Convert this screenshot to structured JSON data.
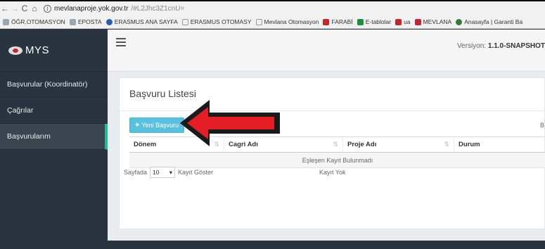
{
  "browser": {
    "url_host": "mevlanaproje.yok.gov.tr",
    "url_rest": "/#L2Jhc3Z1cnU=",
    "bookmarks": [
      {
        "label": "ÖĞR.OTOMASYON",
        "color": "#9aa7b4"
      },
      {
        "label": "EPOSTA",
        "color": "#9aa7b4"
      },
      {
        "label": "ERASMUS ANA SAYFA",
        "color": "#2a5db0"
      },
      {
        "label": "ERASMUS OTOMASY",
        "color": "#bbbbbb"
      },
      {
        "label": "Mevlana Otomasyon",
        "color": "#bbbbbb"
      },
      {
        "label": "FARABİ",
        "color": "#c0282d"
      },
      {
        "label": "E-tablolar",
        "color": "#1e8e3e"
      },
      {
        "label": "ua",
        "color": "#c0282d"
      },
      {
        "label": "MEVLANA",
        "color": "#c0282d"
      },
      {
        "label": "Anasayfa | Garanti Ba",
        "color": "#2e7d32"
      }
    ]
  },
  "app": {
    "brand": "MYS",
    "version_label": "Versiyon:",
    "version_value": "1.1.0-SNAPSHOT",
    "sidebar": {
      "items": [
        {
          "label": "Başvurular (Koordinatör)"
        },
        {
          "label": "Çağrılar"
        },
        {
          "label": "Başvurularım"
        }
      ]
    }
  },
  "main": {
    "title": "Başvuru Listesi",
    "new_button": "Yeni Başvuru",
    "search_cut": "B",
    "table": {
      "columns": [
        "Dönem",
        "Cagri Adı",
        "Proje Adı",
        "Durum"
      ],
      "empty_message": "Eşleşen Kayıt Bulunmadı"
    },
    "pager": {
      "prefix": "Sayfada",
      "page_size": "10",
      "suffix": "Kayıt Göster",
      "status": "Kayıt Yok"
    }
  },
  "colors": {
    "sidebar_bg": "#2a3440",
    "active_accent": "#1abc9c",
    "button_info": "#5bc0de",
    "annotation_arrow": "#e31e24"
  }
}
